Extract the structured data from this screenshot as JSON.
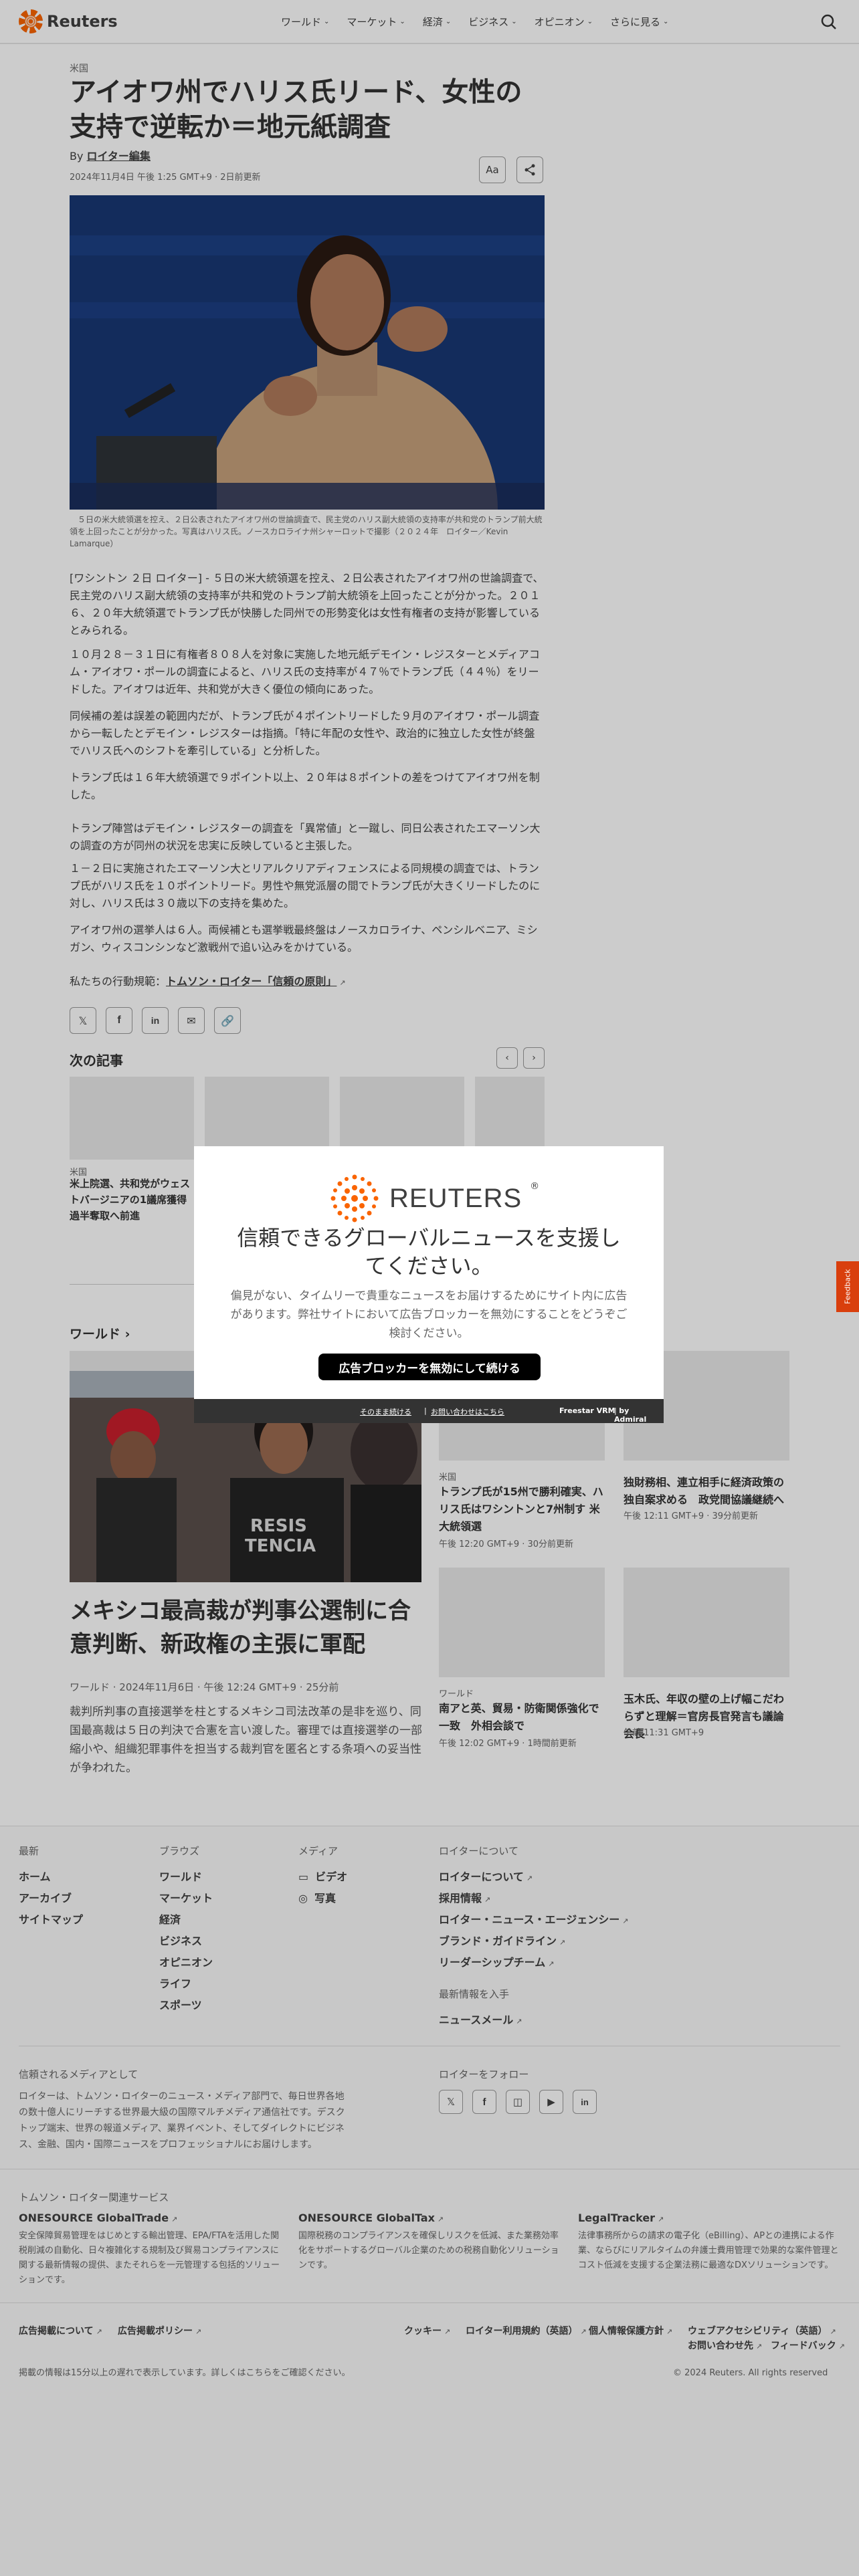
{
  "header": {
    "logo_text": "Reuters",
    "nav": [
      "ワールド",
      "マーケット",
      "経済",
      "ビジネス",
      "オピニオン",
      "さらに見る"
    ]
  },
  "article": {
    "kicker": "米国",
    "title": "アイオワ州でハリス氏リード、女性の支持で逆転か＝地元紙調査",
    "by": "By",
    "author": "ロイター編集",
    "date": "2024年11月4日 午後 1:25 GMT+9 · 2日前更新",
    "text_size_label": "Aa",
    "caption": "　５日の米大統領選を控え、２日公表されたアイオワ州の世論調査で、民主党のハリス副大統領の支持率が共和党のトランプ前大統領を上回ったことが分かった。写真はハリス氏。ノースカロライナ州シャーロットで撮影（２０２４年　ロイター／Kevin Lamarque）",
    "paragraphs": [
      "[ワシントン ２日 ロイター] - ５日の米大統領選を控え、２日公表されたアイオワ州の世論調査で、民主党のハリス副大統領の支持率が共和党のトランプ前大統領を上回ったことが分かった。２０１６、２０年大統領選でトランプ氏が快勝した同州での形勢変化は女性有権者の支持が影響しているとみられる。",
      "１０月２８－３１日に有権者８０８人を対象に実施した地元紙デモイン・レジスターとメディアコム・アイオワ・ポールの調査によると、ハリス氏の支持率が４７％でトランプ氏（４４％）をリードした。アイオワは近年、共和党が大きく優位の傾向にあった。",
      "同候補の差は誤差の範囲内だが、トランプ氏が４ポイントリードした９月のアイオワ・ポール調査から一転したとデモイン・レジスターは指摘。「特に年配の女性や、政治的に独立した女性が終盤でハリス氏へのシフトを牽引している」と分析した。",
      "トランプ氏は１６年大統領選で９ポイント以上、２０年は８ポイントの差をつけてアイオワ州を制した。",
      "トランプ陣営はデモイン・レジスターの調査を「異常値」と一蹴し、同日公表されたエマーソン大の調査の方が同州の状況を忠実に反映していると主張した。",
      "１－２日に実施されたエマーソン大とリアルクリアディフェンスによる同規模の調査では、トランプ氏がハリス氏を１０ポイントリード。男性や無党派層の間でトランプ氏が大きくリードしたのに対し、ハリス氏は３０歳以下の支持を集めた。",
      "アイオワ州の選挙人は６人。両候補とも選挙戦最終盤はノースカロライナ、ペンシルベニア、ミシガン、ウィスコンシンなど激戦州で追い込みをかけている。"
    ],
    "ethics_prefix": "私たちの行動規範：",
    "ethics_link": "トムソン・ロイター「信頼の原則」"
  },
  "next_articles": {
    "title": "次の記事",
    "items": [
      {
        "kicker": "米国",
        "title": "米上院選、共和党がウェストバージニアの1議席獲得 過半奪取へ前進"
      }
    ]
  },
  "world": {
    "title": "ワールド",
    "lead": {
      "title": "メキシコ最高裁が判事公選制に合意判断、新政権の主張に軍配",
      "meta": "ワールド · 2024年11月6日 · 午後 12:24 GMT+9 · 25分前",
      "desc": "裁判所判事の直接選挙を柱とするメキシコ司法改革の是非を巡り、同国最高裁は５日の判決で合憲を言い渡した。審理では直接選挙の一部縮小や、組織犯罪事件を担当する裁判官を匿名とする条項への妥当性が争われた。"
    },
    "cards": [
      {
        "kicker": "米国",
        "title": "トランプ氏が15州で勝利確実、ハリス氏はワシントンと7州制す 米大統領選",
        "time": "午後 12:20 GMT+9 · 30分前更新"
      },
      {
        "kicker": "",
        "title": "独財務相、連立相手に経済政策の独自案求める　政党間協議継続へ",
        "time": "午後 12:11 GMT+9 · 39分前更新"
      },
      {
        "kicker": "ワールド",
        "title": "南アと英、貿易・防衛関係強化で一致　外相会談で",
        "time": "午後 12:02 GMT+9 · 1時間前更新"
      },
      {
        "kicker": "",
        "title": "玉木氏、年収の壁の上げ幅こだわらずと理解＝官房長官発言も議論会長",
        "time": "午前 11:31 GMT+9"
      }
    ]
  },
  "modal": {
    "brand": "REUTERS",
    "headline": "信頼できるグローバルニュースを支援してください。",
    "text": "偏見がない、タイムリーで貴重なニュースをお届けするためにサイト内に広告があります。弊社サイトにおいて広告ブロッカーを無効にすることをどうぞご検討ください。",
    "button": "広告ブロッカーを無効にして続ける",
    "continue": "そのまま続ける",
    "contact": "お問い合わせはこちら",
    "powered": "Freestar VRM",
    "by_admiral": "by Admiral"
  },
  "feedback": "Feedback",
  "footer": {
    "col1": {
      "title": "最新",
      "links": [
        "ホーム",
        "アーカイブ",
        "サイトマップ"
      ]
    },
    "col2": {
      "title": "ブラウズ",
      "links": [
        "ワールド",
        "マーケット",
        "経済",
        "ビジネス",
        "オピニオン",
        "ライフ",
        "スポーツ"
      ]
    },
    "col3": {
      "title": "メディア",
      "links": [
        "ビデオ",
        "写真"
      ]
    },
    "col4": {
      "title": "ロイターについて",
      "links": [
        "ロイターについて",
        "採用情報",
        "ロイター・ニュース・エージェンシー",
        "ブランド・ガイドライン",
        "リーダーシップチーム"
      ]
    },
    "latest_title": "最新情報を入手",
    "newsletter": "ニュースメール",
    "trusted_title": "信頼されるメディアとして",
    "trusted_text": "ロイターは、トムソン・ロイターのニュース・メディア部門で、毎日世界各地の数十億人にリーチする世界最大級の国際マルチメディア通信社です。デスクトップ端末、世界の報道メディア、業界イベント、そしてダイレクトにビジネス、金融、国内・国際ニュースをプロフェッショナルにお届けします。",
    "follow_title": "ロイターをフォロー",
    "services_title": "トムソン・ロイター関連サービス",
    "services": [
      {
        "name": "ONESOURCE GlobalTrade",
        "text": "安全保障貿易管理をはじめとする輸出管理、EPA/FTAを活用した関税削減の自動化、日々複雑化する規制及び貿易コンプライアンスに関する最新情報の提供、またそれらを一元管理する包括的ソリューションです。"
      },
      {
        "name": "ONESOURCE GlobalTax",
        "text": "国際税務のコンプライアンスを確保しリスクを低減、また業務効率化をサポートするグローバル企業のための税務自動化ソリューションです。"
      },
      {
        "name": "LegalTracker",
        "text": "法律事務所からの請求の電子化（eBilling）、APとの連携による作業、ならびにリアルタイムの弁護士費用管理で効果的な案件管理とコスト低減を支援する企業法務に最適なDXソリューションです。"
      }
    ],
    "bottom_links_left": [
      "広告掲載について",
      "広告掲載ポリシー"
    ],
    "bottom_links_right": [
      "クッキー",
      "ロイター利用規約（英語）",
      "個人情報保護方針",
      "ウェブアクセシビリティ（英語）"
    ],
    "contact_feedback": [
      "お問い合わせ先",
      "フィードバック"
    ],
    "disclaimer": "掲載の情報は15分以上の遅れで表示しています。詳しくはこちらをご確認ください。",
    "copyright": "© 2024 Reuters. All rights reserved"
  }
}
